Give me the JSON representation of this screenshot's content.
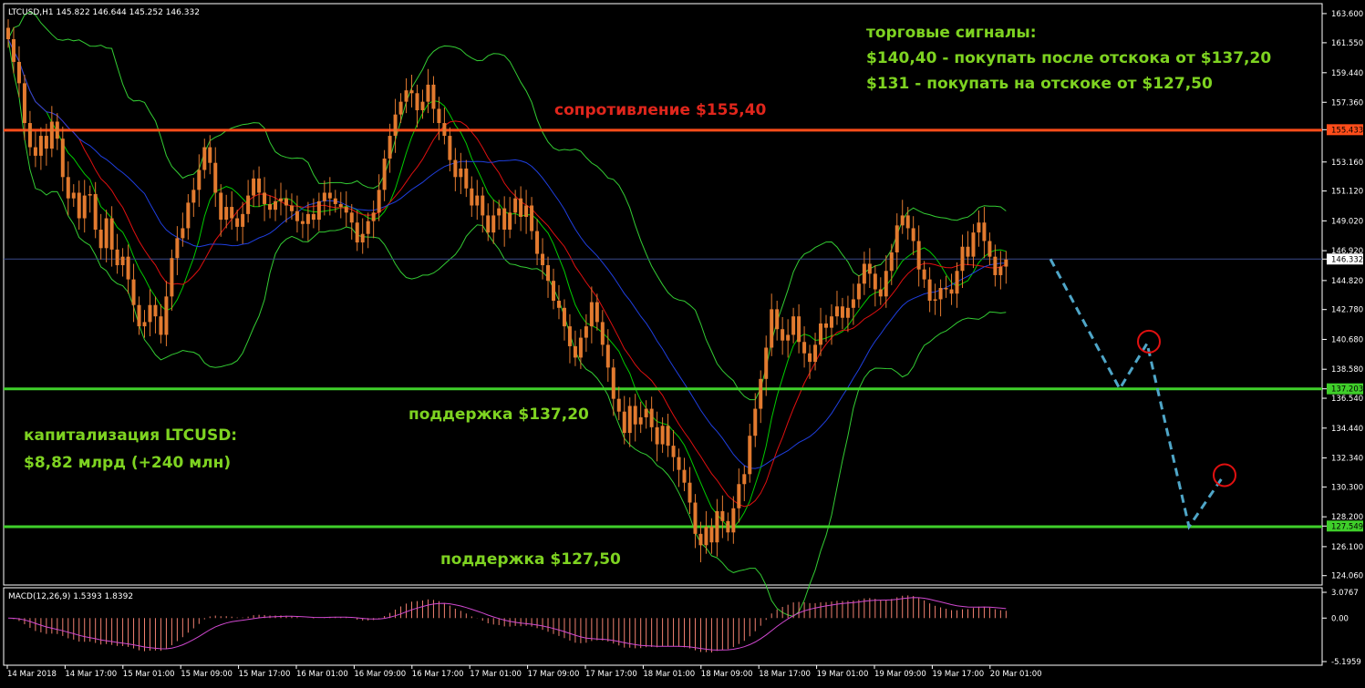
{
  "header": {
    "symbol_info": "LTCUSD,H1  145.822 146.644 145.252 146.332"
  },
  "annotations": {
    "signals_title": "торговые сигналы:",
    "signal_1": "$140,40 - покупать после отскока от $137,20",
    "signal_2": "$131 - покупать на отскоке от $127,50",
    "resistance_label": "сопротивление $155,40",
    "support1_label": "поддержка $137,20",
    "support2_label": "поддержка $127,50",
    "cap_label": "капитализация LTCUSD:",
    "cap_value": "$8,82 млрд (+240 млн)"
  },
  "macd": {
    "label": "MACD(12,26,9) 1.5393 1.8392",
    "ticks": [
      "3.0767",
      "0.00",
      "-5.1959"
    ]
  },
  "colors": {
    "background": "#000000",
    "candle": "#e27a2f",
    "resistance": "#ff4d1a",
    "support": "#3fcf2a",
    "resistance_text": "#e0261c",
    "support_text": "#7ed321",
    "axis": "#ffffff",
    "bollinger": "#33cc33",
    "ma_fast": "#00cc00",
    "ma_red": "#e01010",
    "ma_blue": "#1f3fe0",
    "forecast": "#4fa6c8",
    "target_circle": "#e01010",
    "macd_hist": "#f08070",
    "macd_signal": "#d048d0"
  },
  "chart_data": {
    "type": "candlestick",
    "symbol": "LTCUSD",
    "timeframe": "H1",
    "ohlc_last": {
      "open": 145.822,
      "high": 146.644,
      "low": 145.252,
      "close": 146.332
    },
    "y_ticks": [
      163.6,
      161.55,
      159.44,
      157.36,
      155.433,
      153.16,
      151.12,
      149.02,
      146.92,
      146.332,
      144.82,
      142.78,
      140.68,
      138.58,
      137.203,
      136.54,
      134.44,
      132.34,
      130.3,
      128.2,
      127.549,
      126.1,
      124.06
    ],
    "y_tick_labels": [
      "163.600",
      "161.550",
      "159.440",
      "157.360",
      "155.433",
      "153.160",
      "151.120",
      "149.020",
      "146.920",
      "146.332",
      "144.820",
      "142.780",
      "140.680",
      "138.580",
      "137.203",
      "136.540",
      "134.440",
      "132.340",
      "130.300",
      "128.200",
      "127.549",
      "126.100",
      "124.060"
    ],
    "x_labels": [
      "14 Mar 2018",
      "14 Mar 17:00",
      "15 Mar 01:00",
      "15 Mar 09:00",
      "15 Mar 17:00",
      "16 Mar 01:00",
      "16 Mar 09:00",
      "16 Mar 17:00",
      "17 Mar 01:00",
      "17 Mar 09:00",
      "17 Mar 17:00",
      "18 Mar 01:00",
      "18 Mar 09:00",
      "18 Mar 17:00",
      "19 Mar 01:00",
      "19 Mar 09:00",
      "19 Mar 17:00",
      "20 Mar 01:00"
    ],
    "levels": {
      "resistance": 155.4,
      "support_1": 137.2,
      "support_2": 127.5
    },
    "ylim": [
      123.4,
      164.3
    ],
    "close_series": [
      161.8,
      160.2,
      158.7,
      155.9,
      154.2,
      153.6,
      155.0,
      154.1,
      156.0,
      154.8,
      152.1,
      150.6,
      151.0,
      149.2,
      150.8,
      150.9,
      148.4,
      147.1,
      149.2,
      147.0,
      145.9,
      146.5,
      144.9,
      143.1,
      141.6,
      141.9,
      143.1,
      142.3,
      141.0,
      143.7,
      146.4,
      147.8,
      148.5,
      150.3,
      151.2,
      152.6,
      154.2,
      153.1,
      151.0,
      149.1,
      150.0,
      149.2,
      148.6,
      149.5,
      150.8,
      152.0,
      151.0,
      150.2,
      149.8,
      150.4,
      150.6,
      150.1,
      149.7,
      149.0,
      148.8,
      149.5,
      149.1,
      150.4,
      151.0,
      150.6,
      150.2,
      150.0,
      149.6,
      148.9,
      147.5,
      148.1,
      149.0,
      149.6,
      151.2,
      153.4,
      155.0,
      156.5,
      157.4,
      158.2,
      158.0,
      156.8,
      157.4,
      158.6,
      156.9,
      155.9,
      155.0,
      153.3,
      152.1,
      152.7,
      151.3,
      150.1,
      150.8,
      149.4,
      148.2,
      149.4,
      149.9,
      148.4,
      149.6,
      150.6,
      149.3,
      150.1,
      148.3,
      146.7,
      145.9,
      144.8,
      143.4,
      142.9,
      141.6,
      140.2,
      139.4,
      140.8,
      141.6,
      143.3,
      141.9,
      140.3,
      138.7,
      136.5,
      135.6,
      134.1,
      136.0,
      134.7,
      135.2,
      135.8,
      134.5,
      133.3,
      134.6,
      133.2,
      132.4,
      131.5,
      130.6,
      129.2,
      127.0,
      126.2,
      127.5,
      126.4,
      128.6,
      127.9,
      127.1,
      128.8,
      130.5,
      131.2,
      133.9,
      135.8,
      137.9,
      140.1,
      142.8,
      141.4,
      140.6,
      141.0,
      142.3,
      140.5,
      139.7,
      139.1,
      140.3,
      141.8,
      141.5,
      142.3,
      143.0,
      142.2,
      142.9,
      143.5,
      144.6,
      146.0,
      145.3,
      144.2,
      143.7,
      145.5,
      146.8,
      148.7,
      149.4,
      148.5,
      147.6,
      145.6,
      144.9,
      143.4,
      143.5,
      144.3,
      144.2,
      143.9,
      145.5,
      147.2,
      146.5,
      148.2,
      148.9,
      147.6,
      146.5,
      145.2,
      145.8,
      146.3
    ],
    "forecast_path": [
      {
        "label": "current",
        "price": 146.332
      },
      {
        "label": "support_1",
        "price": 137.2
      },
      {
        "label": "target_1",
        "price": 140.4
      },
      {
        "label": "support_2",
        "price": 127.5
      },
      {
        "label": "target_2",
        "price": 131.0
      }
    ]
  }
}
